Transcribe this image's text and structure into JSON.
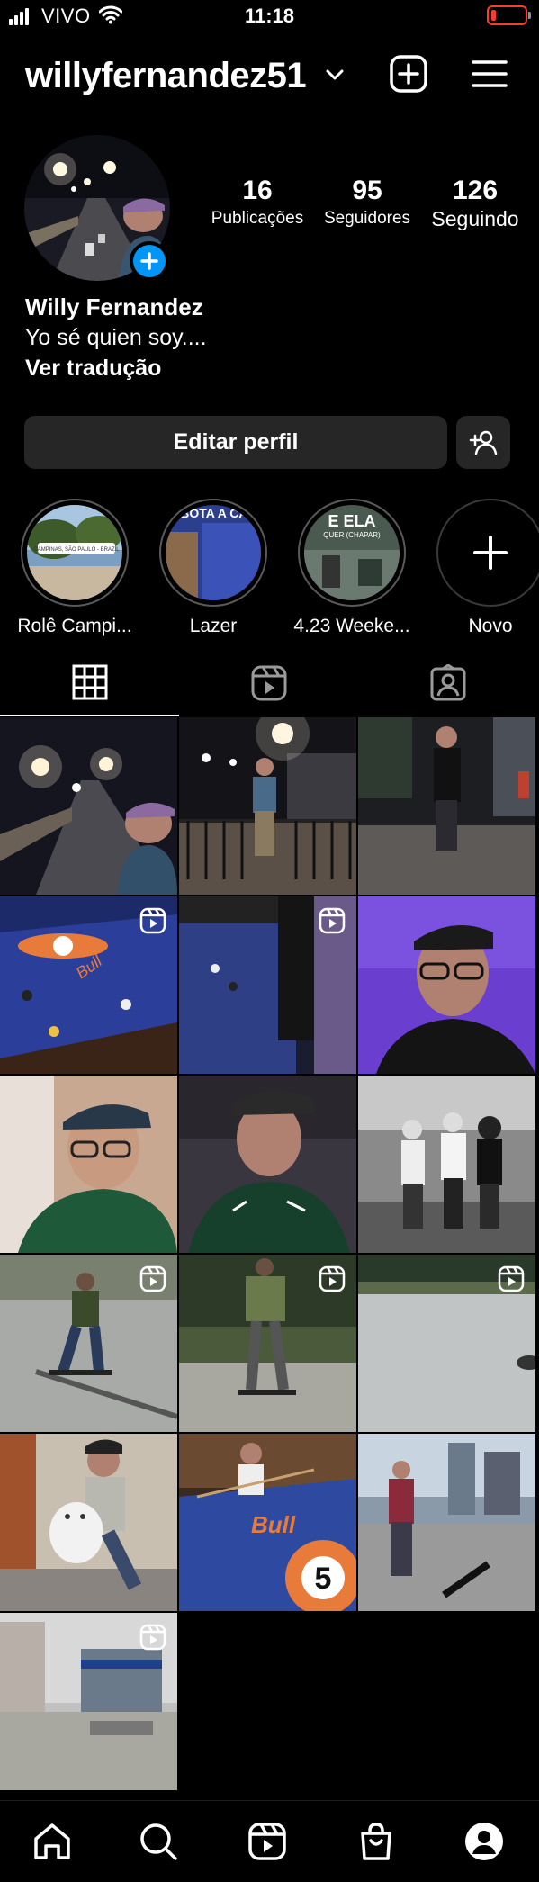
{
  "status_bar": {
    "carrier": "VIVO",
    "time": "11:18"
  },
  "header": {
    "username": "willyfernandez51"
  },
  "profile": {
    "stats": [
      {
        "value": "16",
        "label": "Publicações"
      },
      {
        "value": "95",
        "label": "Seguidores"
      },
      {
        "value": "126",
        "label": "Seguindo"
      }
    ],
    "name": "Willy Fernandez",
    "bio": "Yo sé quien soy....",
    "translate_link": "Ver tradução",
    "edit_button": "Editar perfil"
  },
  "highlights": [
    {
      "label": "Rolê Campi..."
    },
    {
      "label": "Lazer"
    },
    {
      "label": "4.23 Weeke..."
    },
    {
      "label": "Novo"
    }
  ],
  "highlight_overlays": {
    "h1_sticker": "CAMPINAS, SÃO PAULO - BRAZIL",
    "h2_title": "BOTA A CARA",
    "h3_title": "E ELA",
    "h3_sub": "QUER (CHAPAR)"
  },
  "tabs": [
    "posts-grid",
    "reels",
    "tagged"
  ],
  "post_overlays": {
    "ball_text": "Bull",
    "ball_number": "5"
  },
  "colors": {
    "accent": "#0095f6",
    "battery": "#ff3b30",
    "surface": "#262626"
  },
  "nav": [
    "home",
    "search",
    "reels",
    "shop",
    "profile"
  ]
}
